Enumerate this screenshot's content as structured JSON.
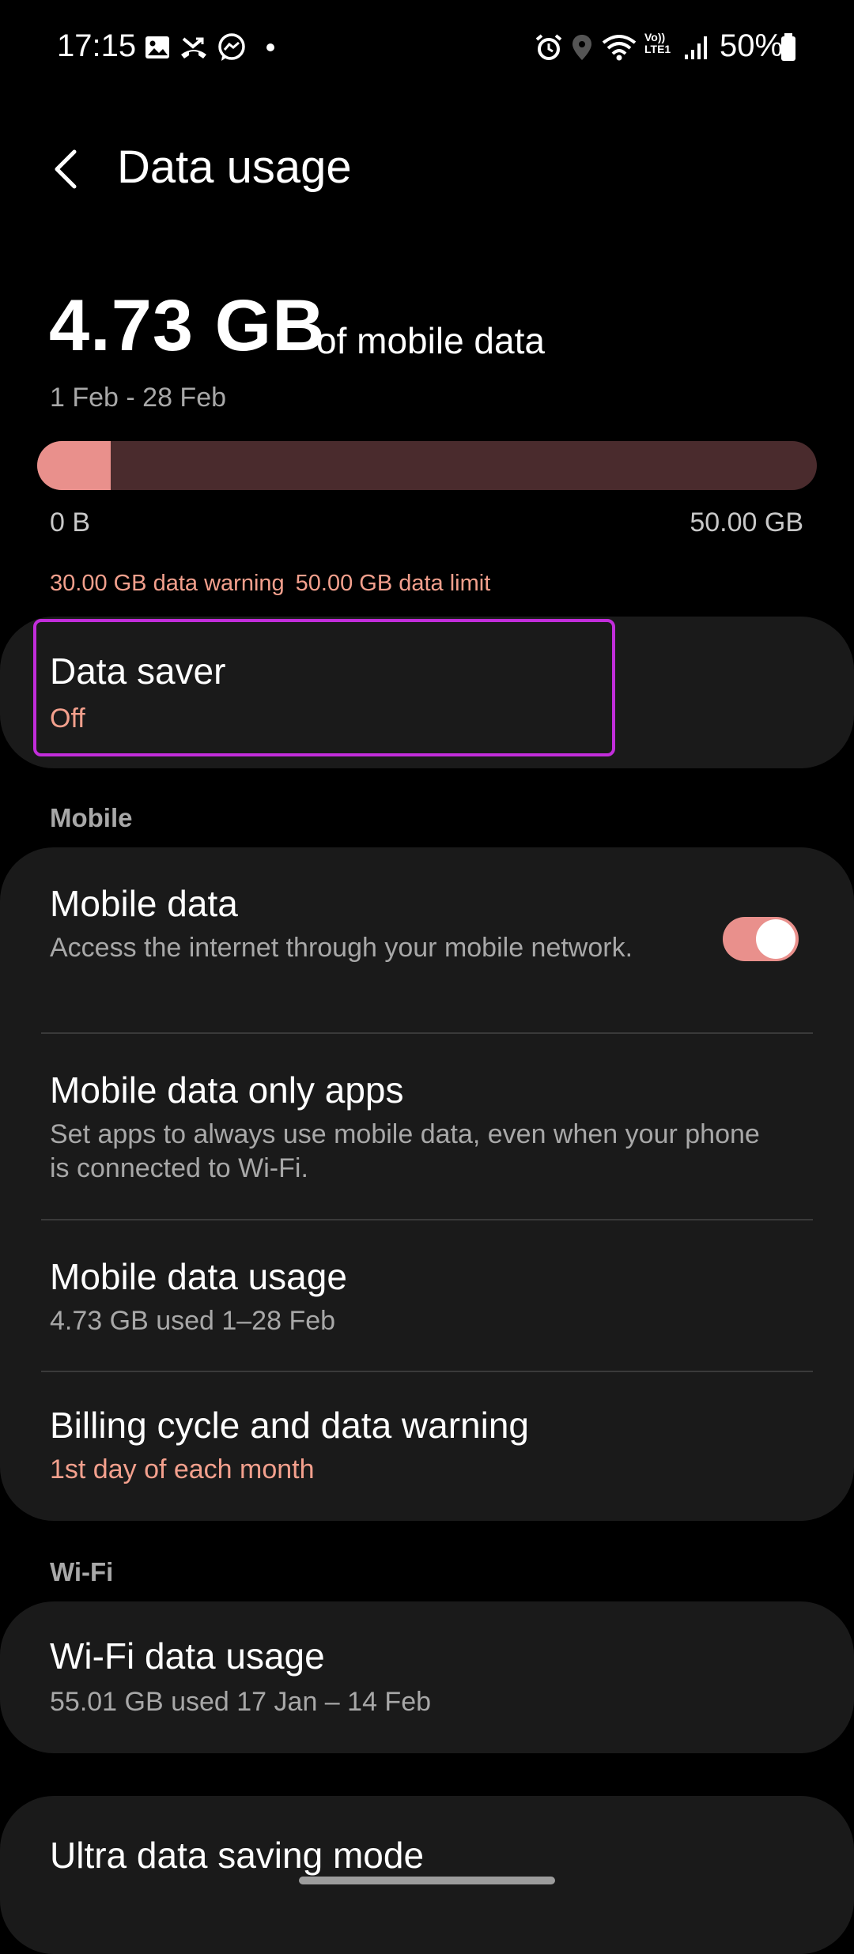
{
  "status_bar": {
    "time": "17:15",
    "battery": "50%",
    "network_label": "Vo)) LTE1"
  },
  "header": {
    "title": "Data usage"
  },
  "usage": {
    "amount": "4.73 GB",
    "suffix": "of mobile data",
    "period": "1 Feb - 28 Feb",
    "used_fraction": 0.0946,
    "bar_min": "0 B",
    "bar_max": "50.00 GB",
    "warning": "30.00 GB data warning",
    "limit": "50.00 GB data limit"
  },
  "data_saver": {
    "title": "Data saver",
    "status": "Off"
  },
  "sections": {
    "mobile": "Mobile",
    "wifi": "Wi-Fi"
  },
  "mobile_items": [
    {
      "title": "Mobile data",
      "sub": "Access the internet through your mobile network.",
      "toggle_on": true
    },
    {
      "title": "Mobile data only apps",
      "sub": "Set apps to always use mobile data, even when your phone is connected to Wi-Fi."
    },
    {
      "title": "Mobile data usage",
      "sub": "4.73 GB used 1–28 Feb"
    },
    {
      "title": "Billing cycle and data warning",
      "sub": "1st day of each month"
    }
  ],
  "wifi_items": [
    {
      "title": "Wi-Fi data usage",
      "sub": "55.01 GB used 17 Jan – 14 Feb"
    }
  ],
  "ultra": {
    "title": "Ultra data saving mode"
  },
  "colors": {
    "accent": "#e9908c",
    "accent_text": "#f3a08d",
    "highlight": "#c22ddb",
    "card_bg": "#1a1a1a"
  },
  "icons": [
    "image-icon",
    "missed-call-icon",
    "messenger-icon",
    "alarm-icon",
    "location-icon",
    "wifi-icon",
    "signal-icon",
    "battery-icon",
    "back-arrow-icon"
  ]
}
